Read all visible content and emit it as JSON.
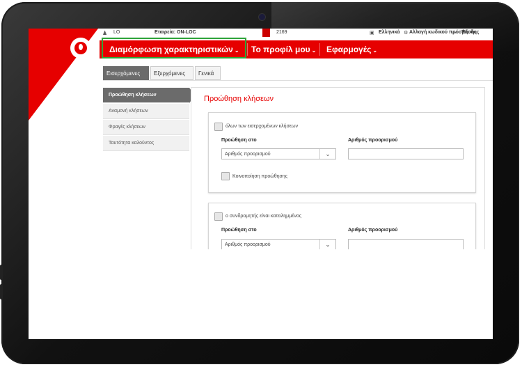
{
  "topbar": {
    "user": "LO",
    "company_label": "Εταιρεία: ON-LOC",
    "counter": "2169",
    "language": "Ελληνικά",
    "change_password": "Αλλαγή κωδικού πρόσβασης",
    "exit": "Έξοδος"
  },
  "nav": {
    "items": [
      {
        "label": "Διαμόρφωση χαρακτηριστικών"
      },
      {
        "label": "Το προφίλ μου"
      },
      {
        "label": "Εφαρμογές"
      }
    ]
  },
  "tabs": [
    {
      "label": "Εισερχόμενες"
    },
    {
      "label": "Εξερχόμενες"
    },
    {
      "label": "Γενικά"
    }
  ],
  "sidebar": {
    "items": [
      {
        "label": "Προώθηση κλήσεων"
      },
      {
        "label": "Αναμονή κλήσεων"
      },
      {
        "label": "Φραγές κλήσεων"
      },
      {
        "label": "Ταυτότητα καλούντος"
      }
    ]
  },
  "main": {
    "title": "Προώθηση κλήσεων",
    "section1": {
      "checkbox_label": "όλων των εισερχομένων κλήσεων",
      "forward_to_label": "Προώθηση στο",
      "forward_to_value": "Αριθμός προορισμού",
      "destination_label": "Αριθμός προορισμού",
      "notify_label": "Κοινοποίηση προώθησης"
    },
    "section2": {
      "checkbox_label": "ο συνδρομητής είναι κατειλημμένος",
      "forward_to_label": "Προώθηση στο",
      "forward_to_value": "Αριθμός προορισμού",
      "destination_label": "Αριθμός προορισμού"
    }
  },
  "colors": {
    "brand_red": "#e60000",
    "highlight_green": "#2ea43a",
    "active_gray": "#6b6b6b"
  }
}
